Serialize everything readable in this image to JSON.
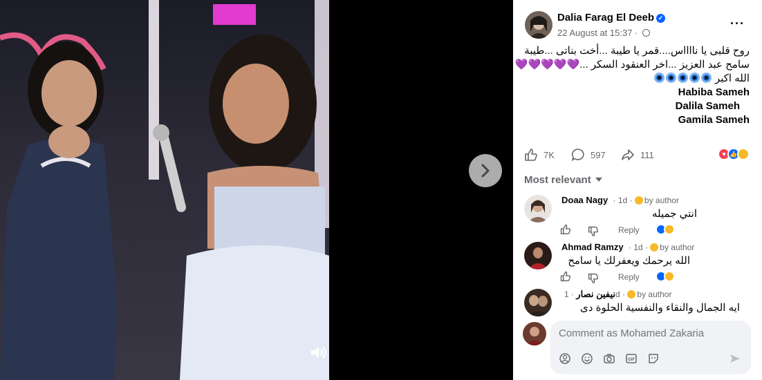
{
  "post": {
    "author": "Dalia Farag El Deeb",
    "time": "22 August at 15:37 · ",
    "caption_lines": [
      "روح قلبى يا نااااس....قمر يا طيبة ...أخت بناتى ...طيبة",
      "سامح عبد العزيز ...اخر العنقود السكر ...",
      "الله اكبر"
    ],
    "names": [
      "Habiba Sameh",
      "Dalila Sameh",
      "Gamila Sameh"
    ],
    "hearts": "💜💜💜💜💜",
    "stats": {
      "likes": "7K",
      "comments": "597",
      "shares": "111"
    }
  },
  "filter_label": "Most relevant",
  "comments": [
    {
      "name": "Doaa Nagy",
      "time": "1d",
      "badge": "by author",
      "text": "انتي جميله",
      "reply": "Reply"
    },
    {
      "name": "Ahmad Ramzy",
      "time": "1d",
      "badge": "by author",
      "text": "الله يرحمك ويعفرلك يا سامح",
      "reply": "Reply"
    },
    {
      "name": "نيفين نصار",
      "time": "1d",
      "badge": "by author",
      "text": "ايه الجمال والنقاء والنفسية الحلوة دى"
    }
  ],
  "composer": {
    "placeholder": "Comment as Mohamed Zakaria"
  },
  "icons": {
    "verified": "verified-badge-icon",
    "globe": "globe-icon",
    "more": "more-dots-icon",
    "like": "like-icon",
    "comment": "comment-icon",
    "share": "share-icon",
    "next": "chevron-right-icon",
    "mute": "speaker-icon",
    "composer": [
      "avatar-icon",
      "emoji-icon",
      "camera-icon",
      "gif-icon",
      "sticker-icon",
      "send-icon"
    ]
  },
  "colors": {
    "accent": "#0866ff",
    "love": "#f33e58",
    "care": "#f7b928",
    "muted": "#65676b"
  }
}
